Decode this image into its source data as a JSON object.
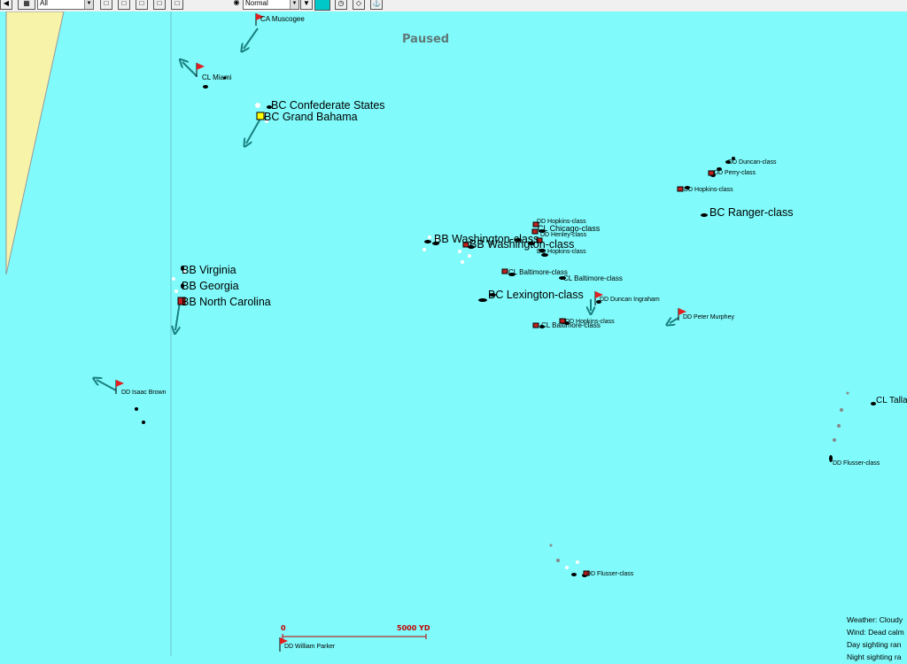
{
  "toolbar": {
    "filter_value": "All",
    "speed_value": "Normal",
    "accent": "#00c8c8"
  },
  "map": {
    "status": "Paused",
    "sea_color": "#80fafa",
    "land_color": "#f7f3a8",
    "track_color": "#1a8080",
    "labels": {
      "ca_muscogee": "CA Muscogee",
      "cl_miami": "CL Miami",
      "bc_confederate_states": "BC Confederate States",
      "bc_grand_bahama": "BC Grand Bahama",
      "dd_duncan_class": "DD Duncan-class",
      "dd_perry_class": "DD Perry-class",
      "dd_hopkins_class_ne": "DD Hopkins-class",
      "bc_ranger_class": "BC Ranger-class",
      "dd_hopkins_class_a": "DD Hopkins-class",
      "cl_chicago_class": "CL Chicago-class",
      "dd_henley_class": "DD Henley-class",
      "bb_washington_class_a": "BB Washington-class",
      "bb_washington_class_b": "BB Washington-class",
      "dd_hopkins_class_b": "DD Hopkins-class",
      "cl_baltimore_class_a": "CL Baltimore-class",
      "cl_baltimore_class_b": "CL Baltimore-class",
      "bc_lexington_class": "BC Lexington-class",
      "dd_duncan_ingraham": "DD Duncan Ingraham",
      "dd_peter_murphey": "DD Peter Murphey",
      "dd_hopkins_class_c": "DD Hopkins-class",
      "cl_baltimore_class_c": "CL Baltimore-class",
      "bb_virginia": "BB Virginia",
      "bb_georgia": "BB Georgia",
      "bb_north_carolina": "BB North Carolina",
      "dd_isaac_brown": "DD Isaac Brown",
      "cl_talla": "CL Talla",
      "dd_flusser_class_e": "DD Flusser-class",
      "dd_flusser_class_s": "DD Flusser-class",
      "dd_william_parker": "DD William Parker"
    }
  },
  "scale": {
    "zero": "0",
    "distance": "5000 YD"
  },
  "weather": {
    "weather": "Weather: Cloudy",
    "wind": "Wind: Dead calm",
    "day": "Day sighting ran",
    "night": "Night sighting ra"
  }
}
